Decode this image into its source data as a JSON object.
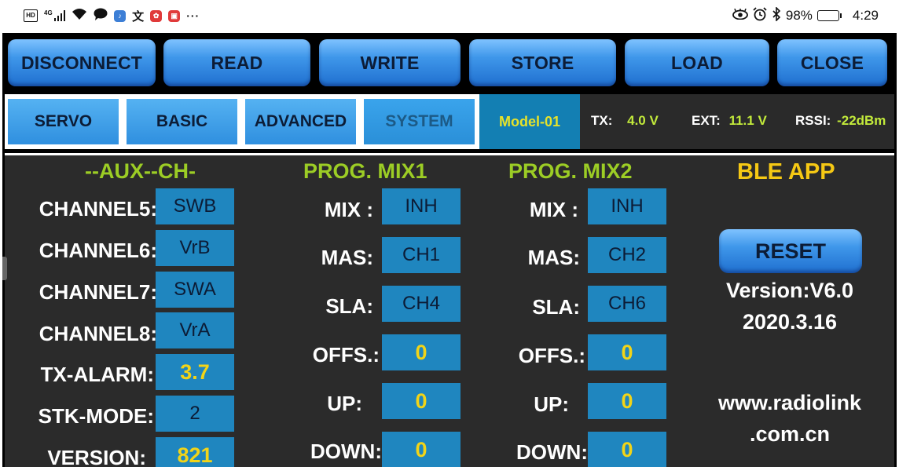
{
  "status_bar": {
    "hd": "HD",
    "network": "4G",
    "dots": "···",
    "battery": "98%",
    "battery_level": 0.98,
    "time": "4:29"
  },
  "toolbar": {
    "disconnect": "DISCONNECT",
    "read": "READ",
    "write": "WRITE",
    "store": "STORE",
    "load": "LOAD",
    "close": "CLOSE"
  },
  "tabs": {
    "servo": "SERVO",
    "basic": "BASIC",
    "advanced": "ADVANCED",
    "system": "SYSTEM",
    "active": "system"
  },
  "status": {
    "model": "Model-01",
    "tx_label": "TX:",
    "tx_value": "4.0 V",
    "ext_label": "EXT:",
    "ext_value": "11.1 V",
    "rssi_label": "RSSI:",
    "rssi_value": "-22dBm"
  },
  "aux": {
    "title": "--AUX--CH-",
    "rows": [
      {
        "label": "CHANNEL5:",
        "value": "SWB"
      },
      {
        "label": "CHANNEL6:",
        "value": "VrB"
      },
      {
        "label": "CHANNEL7:",
        "value": "SWA"
      },
      {
        "label": "CHANNEL8:",
        "value": "VrA"
      },
      {
        "label": "TX-ALARM:",
        "value": "3.7"
      },
      {
        "label": "STK-MODE:",
        "value": "2"
      },
      {
        "label": "VERSION:",
        "value": "821"
      }
    ]
  },
  "mix1": {
    "title": "PROG.  MIX1",
    "rows": [
      {
        "label": "MIX :",
        "value": "INH"
      },
      {
        "label": "MAS:",
        "value": "CH1"
      },
      {
        "label": "SLA:",
        "value": "CH4"
      },
      {
        "label": "OFFS.:",
        "value": "0"
      },
      {
        "label": "UP:",
        "value": "0"
      },
      {
        "label": "DOWN:",
        "value": "0"
      }
    ]
  },
  "mix2": {
    "title": "PROG.  MIX2",
    "rows": [
      {
        "label": "MIX :",
        "value": "INH"
      },
      {
        "label": "MAS:",
        "value": "CH2"
      },
      {
        "label": "SLA:",
        "value": "CH6"
      },
      {
        "label": "OFFS.:",
        "value": "0"
      },
      {
        "label": "UP:",
        "value": "0"
      },
      {
        "label": "DOWN:",
        "value": "0"
      }
    ]
  },
  "ble": {
    "title": "BLE APP",
    "reset": "RESET",
    "version_line1": "Version:V6.0",
    "version_line2": "2020.3.16",
    "site_line1": "www.radiolink",
    "site_line2": ".com.cn"
  },
  "colors": {
    "accent_green": "#9ccd25",
    "accent_yellow": "#f5c814",
    "value_box": "#1f86bf",
    "button_blue": "#3f97ea"
  }
}
